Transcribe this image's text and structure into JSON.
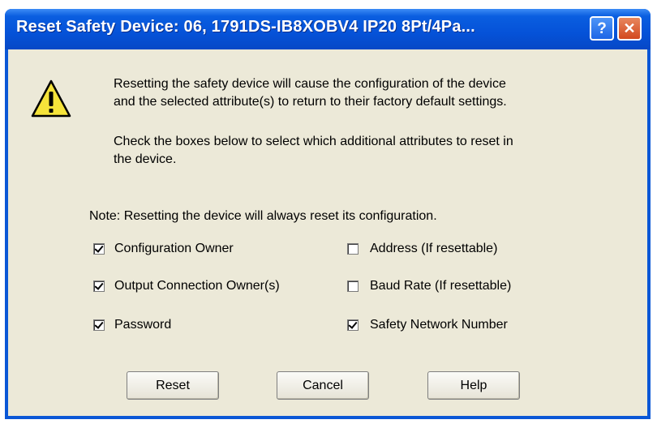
{
  "window": {
    "title": "Reset Safety Device: 06, 1791DS-IB8XOBV4 IP20 8Pt/4Pa...",
    "help_glyph": "?",
    "close_glyph": "✕"
  },
  "message": {
    "icon": "warning-icon",
    "paragraph1_line1": "Resetting the safety device will cause the configuration of the device",
    "paragraph1_line2": "and the selected attribute(s) to return to their factory default settings.",
    "paragraph2_line1": "Check the boxes below to select which additional attributes to reset in",
    "paragraph2_line2": "the device.",
    "note": "Note: Resetting the device will always reset its configuration."
  },
  "options": {
    "configuration_owner": {
      "label": "Configuration Owner",
      "checked": true
    },
    "output_connection_owner": {
      "label": "Output Connection Owner(s)",
      "checked": true
    },
    "password": {
      "label": "Password",
      "checked": true
    },
    "address": {
      "label": "Address (If resettable)",
      "checked": false
    },
    "baud_rate": {
      "label": "Baud Rate (If resettable)",
      "checked": false
    },
    "safety_network_number": {
      "label": "Safety Network Number",
      "checked": true
    }
  },
  "buttons": {
    "reset": "Reset",
    "cancel": "Cancel",
    "help": "Help"
  },
  "colors": {
    "titlebar_blue": "#0552d8",
    "dialog_face": "#ece9d8",
    "close_red": "#d2481e",
    "warning_yellow": "#f5e33a"
  }
}
